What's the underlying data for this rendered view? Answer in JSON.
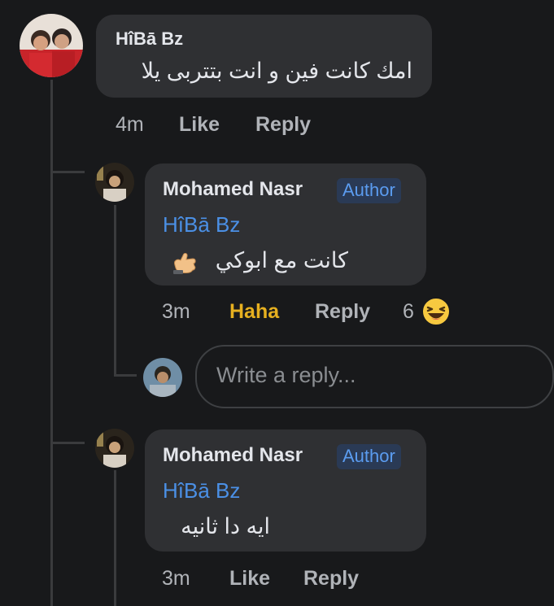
{
  "comments": [
    {
      "author": "HîBā Bz",
      "text": "امك كانت فين و انت بتتربى يلا",
      "time": "4m",
      "like_label": "Like",
      "reply_label": "Reply"
    }
  ],
  "replies": [
    {
      "author": "Mohamed Nasr",
      "badge": "Author",
      "mention": "HîBā Bz",
      "text": "كانت مع ابوكي",
      "emoji": "call-me-hand-icon",
      "time": "3m",
      "reaction_label": "Haha",
      "reply_label": "Reply",
      "reaction_count": "6",
      "reaction_icon": "haha-reaction-icon"
    },
    {
      "author": "Mohamed Nasr",
      "badge": "Author",
      "mention": "HîBā Bz",
      "text": "ايه دا ثانيه",
      "time": "3m",
      "like_label": "Like",
      "reply_label": "Reply"
    }
  ],
  "reply_box": {
    "placeholder": "Write a reply..."
  },
  "colors": {
    "background": "#18191b",
    "bubble": "#2f3033",
    "mention": "#4b90e6",
    "haha": "#e6b020",
    "badge_bg": "#2a3a55",
    "badge_text": "#5b9cf0"
  }
}
